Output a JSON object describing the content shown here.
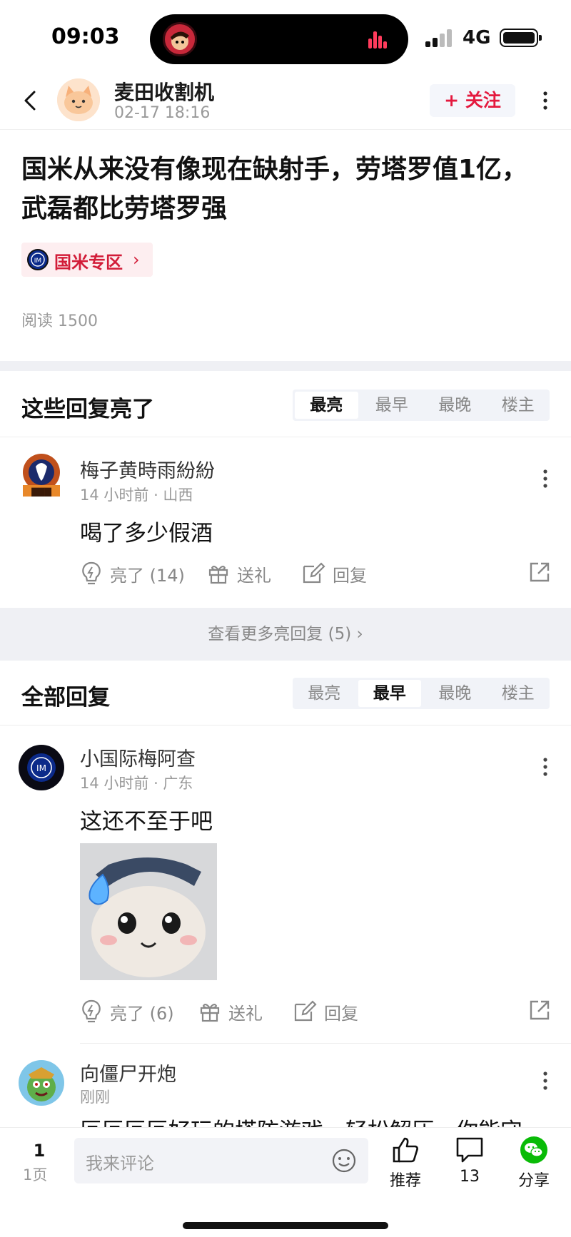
{
  "status": {
    "time": "09:03",
    "network": "4G"
  },
  "topnav": {
    "author": "麦田收割机",
    "time": "02-17 18:16",
    "follow_label": "+ 关注"
  },
  "post": {
    "title": "国米从来没有像现在缺射手，劳塔罗值1亿，武磊都比劳塔罗强",
    "zone": "国米专区",
    "read_label": "阅读 1500"
  },
  "highlight": {
    "title": "这些回复亮了",
    "tabs": [
      "最亮",
      "最早",
      "最晚",
      "楼主"
    ],
    "active_tab": 0,
    "comment": {
      "name": "梅子黄時雨紛紛",
      "meta": "14 小时前 · 山西",
      "text": "喝了多少假酒",
      "like": "亮了 (14)",
      "gift": "送礼",
      "reply": "回复"
    },
    "more_label": "查看更多亮回复 (5)"
  },
  "all": {
    "title": "全部回复",
    "tabs": [
      "最亮",
      "最早",
      "最晚",
      "楼主"
    ],
    "active_tab": 1,
    "comments": [
      {
        "name": "小国际梅阿查",
        "meta": "14 小时前 · 广东",
        "text": "这还不至于吧",
        "like": "亮了 (6)",
        "gift": "送礼",
        "reply": "回复"
      },
      {
        "name": "向僵尸开炮",
        "meta": "刚刚",
        "text": "叵叵叵叵好玩的塔防游戏，轻松解压，你能守"
      }
    ]
  },
  "bottom": {
    "page_num": "1",
    "page_label": "1页",
    "input_placeholder": "我来评论",
    "recommend_label": "推荐",
    "comment_count": "13",
    "share_label": "分享"
  },
  "colors": {
    "accent": "#e4193e",
    "wechat": "#09bb07",
    "inter_blue": "#0b2a8a"
  }
}
